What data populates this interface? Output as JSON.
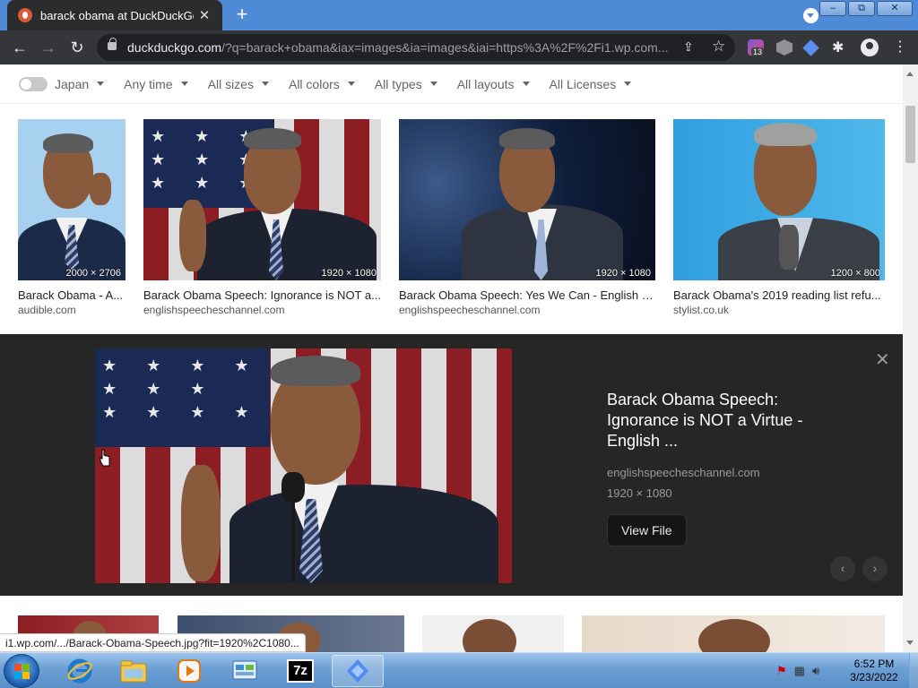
{
  "browser": {
    "tab_title": "barack obama at DuckDuckGo",
    "tab_close": "✕",
    "new_tab": "+",
    "window_buttons": {
      "minimize": "–",
      "maximize": "⧉",
      "close": "✕"
    },
    "nav": {
      "back": "←",
      "forward": "→",
      "reload": "↻"
    },
    "url_host": "duckduckgo.com",
    "url_path": "/?q=barack+obama&iax=images&ia=images&iai=https%3A%2F%2Fi1.wp.com...",
    "share_icon": "⇪",
    "star_icon": "☆",
    "extension_badge": "13",
    "extensions_icon": "✱",
    "menu_icon": "⋮"
  },
  "filters": {
    "region": "Japan",
    "time": "Any time",
    "size": "All sizes",
    "color": "All colors",
    "type": "All types",
    "layout": "All layouts",
    "license": "All Licenses"
  },
  "results": [
    {
      "title": "Barack Obama - A...",
      "source": "audible.com",
      "dims": "2000 × 2706"
    },
    {
      "title": "Barack Obama Speech: Ignorance is NOT a...",
      "source": "englishspeecheschannel.com",
      "dims": "1920 × 1080"
    },
    {
      "title": "Barack Obama Speech: Yes We Can - English S...",
      "source": "englishspeecheschannel.com",
      "dims": "1920 × 1080"
    },
    {
      "title": "Barack Obama's 2019 reading list refu...",
      "source": "stylist.co.uk",
      "dims": "1200 × 800"
    }
  ],
  "preview": {
    "title": "Barack Obama Speech: Ignorance is NOT a Virtue - English ...",
    "source": "englishspeecheschannel.com",
    "dims": "1920 × 1080",
    "view_file": "View File",
    "close": "✕",
    "prev": "‹",
    "next": "›"
  },
  "status_url": "i1.wp.com/.../Barack-Obama-Speech.jpg?fit=1920%2C1080...",
  "taskbar": {
    "time": "6:52 PM",
    "date": "3/23/2022",
    "sevenzip_label": "7z"
  },
  "colors": {
    "tabbar": "#4f8ad6",
    "toolbar": "#35363a",
    "preview_bg": "#262626",
    "ddg_orange": "#de5833"
  }
}
